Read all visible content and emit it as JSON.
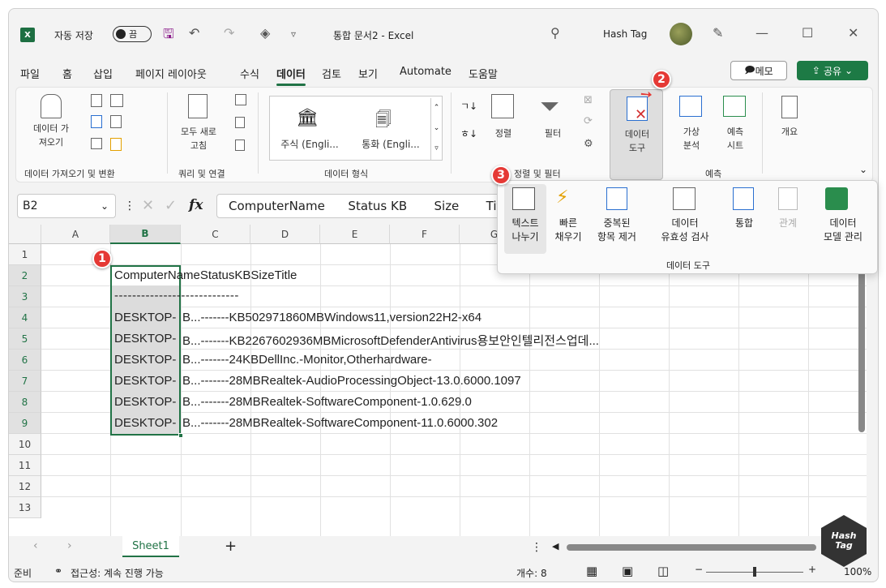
{
  "title": {
    "autosave": "자동 저장",
    "toggle": "끔",
    "filename": "통합 문서2 - Excel",
    "user": "Hash Tag"
  },
  "menu": [
    "파일",
    "홈",
    "삽입",
    "페이지 레이아웃",
    "수식",
    "데이터",
    "검토",
    "보기",
    "Automate",
    "도움말"
  ],
  "memo": "메모",
  "share": "공유",
  "ribbon": {
    "get_data": "데이터 가\n져오기",
    "refresh": "모두 새로\n고침",
    "stocks": "주식 (Engli...",
    "currency": "통화 (Engli...",
    "sort": "정렬",
    "filter": "필터",
    "data_tools": "데이터\n도구",
    "whatif": "가상\n분석",
    "forecast_sheet": "예측\n시트",
    "outline": "개요",
    "groups": {
      "get": "데이터 가져오기 및 변환",
      "query": "쿼리 및 연결",
      "types": "데이터 형식",
      "sortfilter": "정렬 및 필터",
      "forecast": "예측"
    }
  },
  "namebox": "B2",
  "formula": "ComputerName      Status KB       Size       Title",
  "columns": [
    "A",
    "B",
    "C",
    "D",
    "E",
    "F",
    "G"
  ],
  "rows": [
    "1",
    "2",
    "3",
    "4",
    "5",
    "6",
    "7",
    "8",
    "9",
    "10",
    "11",
    "12",
    "13"
  ],
  "cells": {
    "r2": "ComputerNameStatusKBSizeTitle",
    "r3": "----------------------------",
    "r4b": "DESKTOP-",
    "r4": "B...-------KB502971860MBWindows11,version22H2-x64",
    "r5b": "DESKTOP-",
    "r5": "B...-------KB2267602936MBMicrosoftDefenderAntivirus용보안인텔리전스업데...",
    "r6b": "DESKTOP-",
    "r6": "B...-------24KBDellInc.-Monitor,Otherhardware-",
    "r7b": "DESKTOP-",
    "r7": "B...-------28MBRealtek-AudioProcessingObject-13.0.6000.1097",
    "r8b": "DESKTOP-",
    "r8": "B...-------28MBRealtek-SoftwareComponent-1.0.629.0",
    "r9b": "DESKTOP-",
    "r9": "B...-------28MBRealtek-SoftwareComponent-11.0.6000.302"
  },
  "popup": {
    "text_to_columns": "텍스트\n나누기",
    "flash_fill": "빠른\n채우기",
    "remove_dup": "중복된\n항목 제거",
    "validation": "데이터\n유효성 검사",
    "consolidate": "통합",
    "relations": "관계",
    "data_model": "데이터\n모델 관리",
    "group": "데이터 도구"
  },
  "sheet": "Sheet1",
  "status": {
    "ready": "준비",
    "access": "접근성: 계속 진행 가능",
    "count": "개수: 8",
    "zoom": "100%"
  },
  "badges": [
    "1",
    "2",
    "3"
  ],
  "watermark": "Hash Tag"
}
